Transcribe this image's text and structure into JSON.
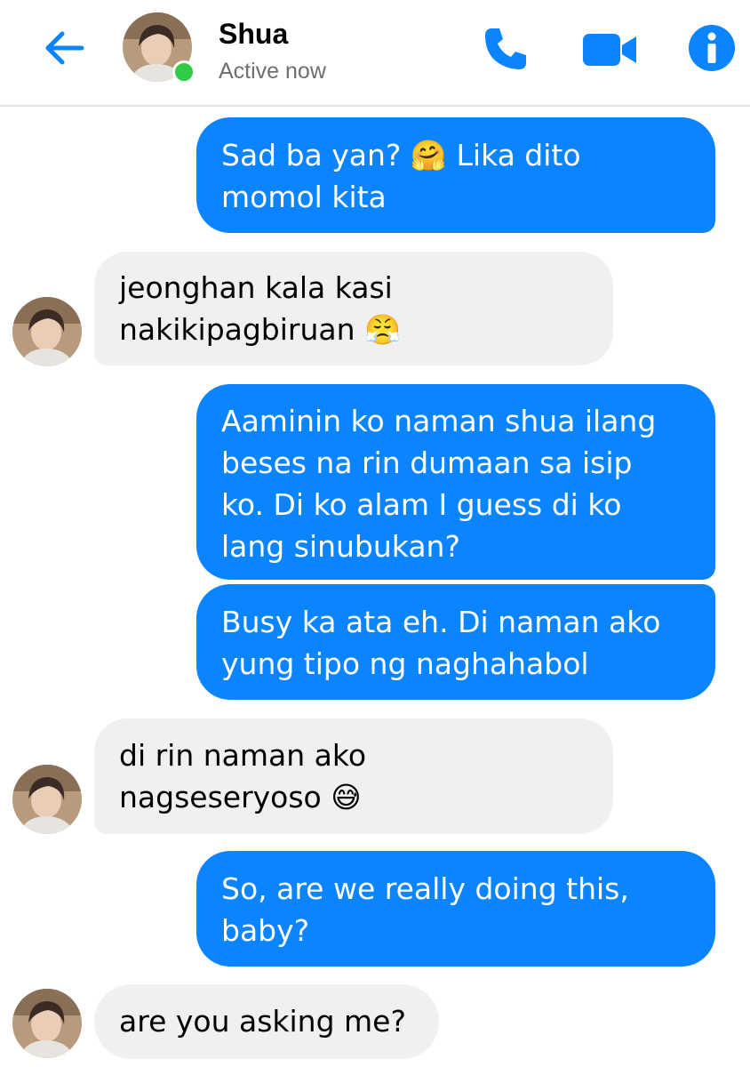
{
  "header": {
    "contact_name": "Shua",
    "status": "Active now",
    "back_icon": "arrow-left-icon",
    "call_icon": "phone-icon",
    "video_icon": "video-camera-icon",
    "info_icon": "info-icon",
    "accent_color": "#0a84ff",
    "online_color": "#31cc46"
  },
  "messages": [
    {
      "from": "me",
      "lines": [
        "Sad ba yan? 🤗 Lika dito",
        "momol kita"
      ],
      "emoji": "hugging-face"
    },
    {
      "from": "Shua",
      "lines": [
        "jeonghan kala kasi",
        "nakikipagbiruan 😤"
      ],
      "emoji": "face-with-steam"
    },
    {
      "from": "me",
      "lines": [
        "Aaminin ko naman shua ilang",
        "beses na rin dumaan sa isip",
        "ko. Di ko alam I guess di ko",
        "lang sinubukan?"
      ]
    },
    {
      "from": "me",
      "lines": [
        "Busy ka ata eh. Di naman ako",
        "yung tipo ng naghahabol"
      ]
    },
    {
      "from": "Shua",
      "lines": [
        "di rin naman ako",
        "nagseseryoso 😅"
      ],
      "emoji": "grinning-sweat"
    },
    {
      "from": "me",
      "lines": [
        "So, are we really doing this,",
        "baby?"
      ]
    },
    {
      "from": "Shua",
      "lines": [
        "are you asking me?"
      ]
    }
  ],
  "colors": {
    "sent_bubble": "#0a84ff",
    "received_bubble": "#f0f0f0"
  }
}
